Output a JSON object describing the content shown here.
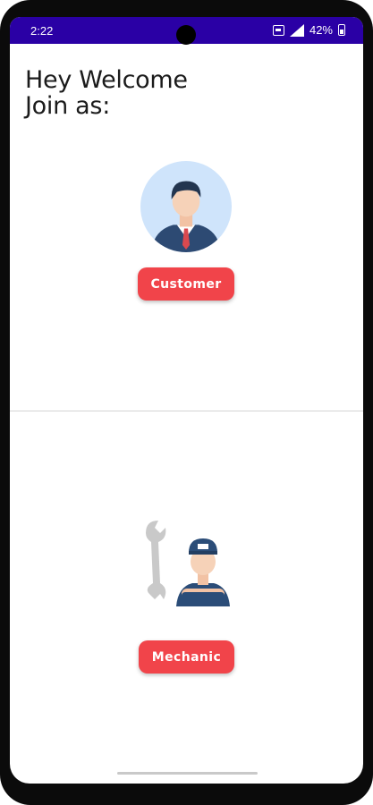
{
  "status_bar": {
    "time": "2:22",
    "battery": "42%",
    "background_color": "#2a00a5"
  },
  "greeting": {
    "line1": "Hey Welcome",
    "line2": "Join as:"
  },
  "roles": {
    "customer": {
      "label": "Customer",
      "icon": "businessman-avatar-icon"
    },
    "mechanic": {
      "label": "Mechanic",
      "icon": "mechanic-with-wrench-icon"
    }
  },
  "colors": {
    "accent": "#f1444a",
    "customer_avatar_bg": "#cfe4fb"
  }
}
